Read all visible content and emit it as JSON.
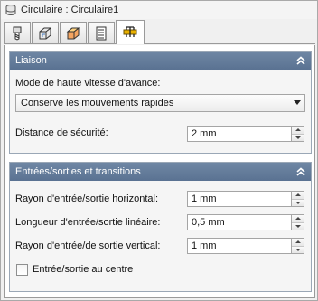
{
  "window": {
    "title": "Circulaire : Circulaire1",
    "title_icon": "stack-icon"
  },
  "tabs": [
    {
      "icon": "tool-icon",
      "active": false
    },
    {
      "icon": "shape-icon",
      "active": false
    },
    {
      "icon": "box-icon",
      "active": false
    },
    {
      "icon": "table-icon",
      "active": false
    },
    {
      "icon": "linking-icon",
      "active": true
    }
  ],
  "liaison": {
    "header": "Liaison",
    "mode_label": "Mode de haute vitesse d'avance:",
    "mode_value": "Conserve les mouvements rapides",
    "distance_label": "Distance de sécurité:",
    "distance_value": "2 mm"
  },
  "transitions": {
    "header": "Entrées/sorties et transitions",
    "radius_h_label": "Rayon d'entrée/sortie horizontal:",
    "radius_h_value": "1 mm",
    "length_label": "Longueur d'entrée/sortie linéaire:",
    "length_value": "0,5 mm",
    "radius_v_label": "Rayon d'entrée/de sortie vertical:",
    "radius_v_value": "1 mm",
    "center_checkbox_label": "Entrée/sortie au centre",
    "center_checkbox_checked": false
  },
  "colors": {
    "section_header": "#5f7898",
    "accent_tab": "#e8b000"
  }
}
